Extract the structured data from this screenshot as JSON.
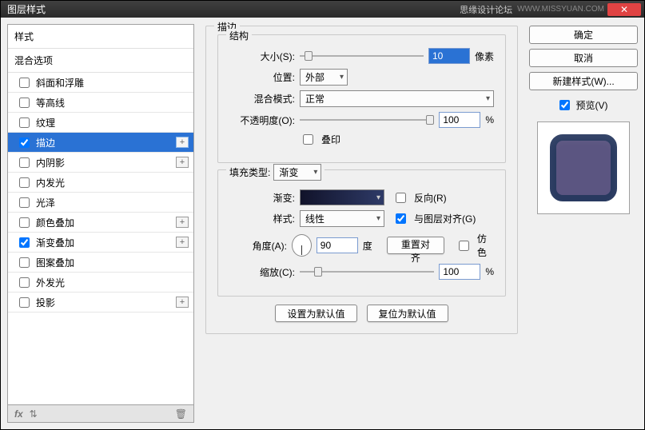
{
  "window": {
    "title": "图层样式",
    "brand": "思缘设计论坛",
    "watermark": "WWW.MISSYUAN.COM"
  },
  "styles": {
    "header": "样式",
    "sub_header": "混合选项",
    "items": [
      {
        "label": "斜面和浮雕",
        "checked": false,
        "plus": false
      },
      {
        "label": "等高线",
        "checked": false,
        "plus": false
      },
      {
        "label": "纹理",
        "checked": false,
        "plus": false
      },
      {
        "label": "描边",
        "checked": true,
        "plus": true,
        "selected": true
      },
      {
        "label": "内阴影",
        "checked": false,
        "plus": true
      },
      {
        "label": "内发光",
        "checked": false,
        "plus": false
      },
      {
        "label": "光泽",
        "checked": false,
        "plus": false
      },
      {
        "label": "颜色叠加",
        "checked": false,
        "plus": true
      },
      {
        "label": "渐变叠加",
        "checked": true,
        "plus": true
      },
      {
        "label": "图案叠加",
        "checked": false,
        "plus": false
      },
      {
        "label": "外发光",
        "checked": false,
        "plus": false
      },
      {
        "label": "投影",
        "checked": false,
        "plus": true
      }
    ]
  },
  "footer": {
    "fx": "fx"
  },
  "main": {
    "title": "描边",
    "structure": {
      "legend": "结构",
      "size_label": "大小(S):",
      "size_value": "10",
      "size_unit": "像素",
      "position_label": "位置:",
      "position_value": "外部",
      "blend_label": "混合模式:",
      "blend_value": "正常",
      "opacity_label": "不透明度(O):",
      "opacity_value": "100",
      "opacity_unit": "%",
      "overprint_label": "叠印"
    },
    "fill": {
      "legend_label": "填充类型:",
      "legend_value": "渐变",
      "grad_label": "渐变:",
      "reverse_label": "反向(R)",
      "style_label": "样式:",
      "style_value": "线性",
      "align_label": "与图层对齐(G)",
      "angle_label": "角度(A):",
      "angle_value": "90",
      "angle_unit": "度",
      "reset_align": "重置对齐",
      "dither_label": "仿色",
      "scale_label": "缩放(C):",
      "scale_value": "100",
      "scale_unit": "%"
    },
    "buttons": {
      "set_default": "设置为默认值",
      "reset_default": "复位为默认值"
    }
  },
  "right": {
    "ok": "确定",
    "cancel": "取消",
    "new_style": "新建样式(W)...",
    "preview_label": "预览(V)"
  }
}
